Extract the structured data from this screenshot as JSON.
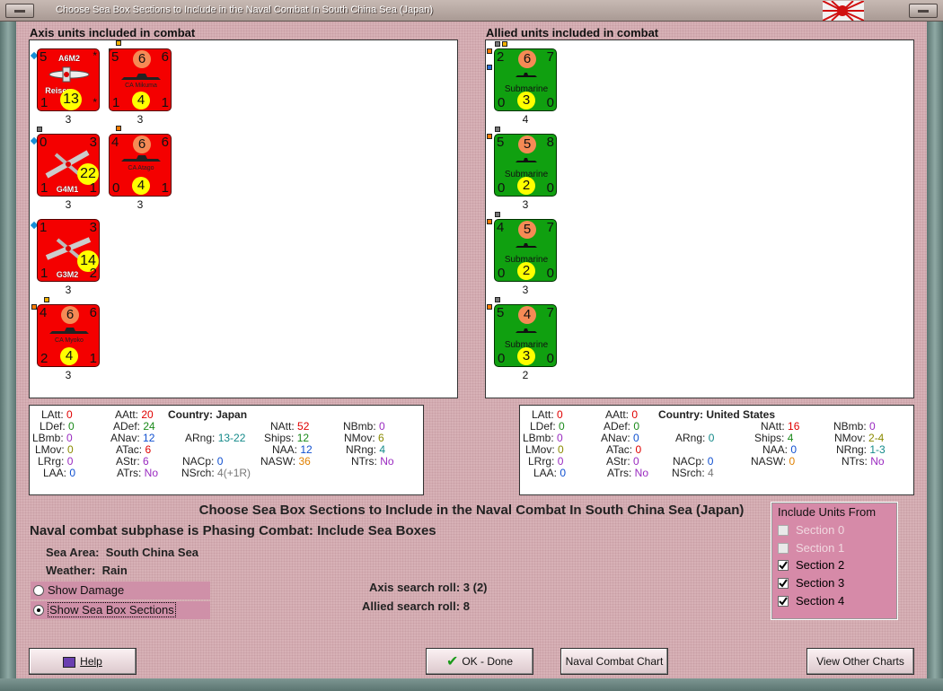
{
  "window": {
    "title": "Choose Sea Box Sections to Include in the Naval Combat In South China Sea (Japan)"
  },
  "axis": {
    "heading": "Axis units included in combat",
    "units": [
      {
        "name": "A6M2",
        "sub": "Reisen",
        "tl": "5",
        "tr": "",
        "bl": "1",
        "br": "",
        "disc": "13",
        "below": "3"
      },
      {
        "name": "CA Mikuma",
        "tl": "5",
        "top": "6",
        "tr": "6",
        "bl": "1",
        "bot": "4",
        "br": "1",
        "below": "3"
      },
      {
        "name": "G4M1",
        "tl": "0",
        "tr": "3",
        "bl": "1",
        "br": "1",
        "disc": "22",
        "below": "3"
      },
      {
        "name": "CA Atago",
        "tl": "4",
        "top": "6",
        "tr": "6",
        "bl": "0",
        "bot": "4",
        "br": "1",
        "below": "3"
      },
      {
        "name": "G3M2",
        "tl": "1",
        "tr": "3",
        "bl": "1",
        "br": "2",
        "disc": "14",
        "below": "3"
      },
      {
        "name": "CA Myoko",
        "tl": "4",
        "top": "6",
        "tr": "6",
        "bl": "2",
        "bot": "4",
        "br": "1",
        "below": "3"
      }
    ],
    "stats": {
      "country_label": "Country:",
      "country": "Japan",
      "LAtt": "0",
      "LDef": "0",
      "LBmb": "0",
      "LMov": "0",
      "LRrg": "0",
      "LAA": "0",
      "AAtt": "20",
      "ADef": "24",
      "ANav": "12",
      "ATac": "6",
      "AStr": "6",
      "ATrs": "No",
      "ARng": "13-22",
      "NACp": "0",
      "NSrch": "4(+1R)",
      "NAtt": "52",
      "Ships": "12",
      "NAA": "12",
      "NASW": "36",
      "NBmb": "0",
      "NMov": "6",
      "NRng": "4",
      "NTrs": "No"
    }
  },
  "allied": {
    "heading": "Allied units included in combat",
    "units": [
      {
        "name": "Submarine",
        "tl": "2",
        "top": "6",
        "tr": "7",
        "bl": "0",
        "bot": "3",
        "br": "0",
        "below": "4"
      },
      {
        "name": "Submarine",
        "tl": "5",
        "top": "5",
        "tr": "8",
        "bl": "0",
        "bot": "2",
        "br": "0",
        "below": "3"
      },
      {
        "name": "Submarine",
        "tl": "4",
        "top": "5",
        "tr": "7",
        "bl": "0",
        "bot": "2",
        "br": "0",
        "below": "3"
      },
      {
        "name": "Submarine",
        "tl": "5",
        "top": "4",
        "tr": "7",
        "bl": "0",
        "bot": "3",
        "br": "0",
        "below": "2"
      }
    ],
    "stats": {
      "country_label": "Country:",
      "country": "United States",
      "LAtt": "0",
      "LDef": "0",
      "LBmb": "0",
      "LMov": "0",
      "LRrg": "0",
      "LAA": "0",
      "AAtt": "0",
      "ADef": "0",
      "ANav": "0",
      "ATac": "0",
      "AStr": "0",
      "ATrs": "No",
      "ARng": "0",
      "NACp": "0",
      "NSrch": "4",
      "NAtt": "16",
      "Ships": "4",
      "NAA": "0",
      "NASW": "0",
      "NBmb": "0",
      "NMov": "2-4",
      "NRng": "1-3",
      "NTrs": "No"
    }
  },
  "labels": {
    "LAtt": "LAtt:",
    "LDef": "LDef:",
    "LBmb": "LBmb:",
    "LMov": "LMov:",
    "LRrg": "LRrg:",
    "LAA": "LAA:",
    "AAtt": "AAtt:",
    "ADef": "ADef:",
    "ANav": "ANav:",
    "ATac": "ATac:",
    "AStr": "AStr:",
    "ATrs": "ATrs:",
    "ARng": "ARng:",
    "NACp": "NACp:",
    "NSrch": "NSrch:",
    "NAtt": "NAtt:",
    "Ships": "Ships:",
    "NAA": "NAA:",
    "NASW": "NASW:",
    "NBmb": "NBmb:",
    "NMov": "NMov:",
    "NRng": "NRng:",
    "NTrs": "NTrs:"
  },
  "main": {
    "title": "Choose Sea Box Sections to Include in the Naval Combat In South China Sea (Japan)",
    "subphase": "Naval combat subphase is Phasing Combat: Include Sea Boxes",
    "sea_area_label": "Sea Area:",
    "sea_area": "South China Sea",
    "weather_label": "Weather:",
    "weather": "Rain",
    "axis_roll_label": "Axis search roll:",
    "axis_roll": "3 (2)",
    "allied_roll_label": "Allied search roll:",
    "allied_roll": "8",
    "show_damage": "Show Damage",
    "show_sections": "Show Sea Box Sections"
  },
  "include": {
    "title": "Include Units From",
    "sections": [
      {
        "label": "Section 0",
        "checked": false,
        "enabled": false
      },
      {
        "label": "Section 1",
        "checked": false,
        "enabled": false
      },
      {
        "label": "Section 2",
        "checked": true,
        "enabled": true
      },
      {
        "label": "Section 3",
        "checked": true,
        "enabled": true
      },
      {
        "label": "Section 4",
        "checked": true,
        "enabled": true
      }
    ]
  },
  "buttons": {
    "help": "Help",
    "ok": "OK - Done",
    "naval_chart": "Naval Combat Chart",
    "other_charts": "View Other Charts"
  },
  "colors": {
    "axis_counter": "#f40000",
    "allied_counter": "#10a010",
    "background": "#d7b1b6"
  }
}
